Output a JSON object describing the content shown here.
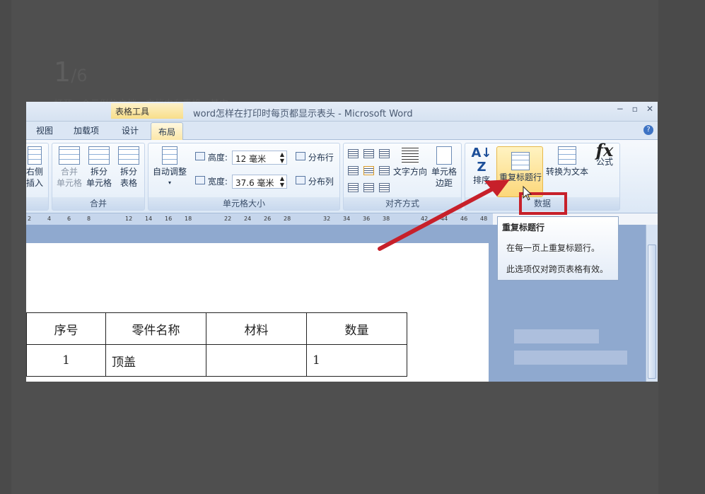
{
  "step": {
    "current": "1",
    "total": "/6"
  },
  "faded_caption": "打开一个示例的文档，文档中有表格，其中",
  "window": {
    "context_tab": "表格工具",
    "title": "word怎样在打印时每页都显示表头 - Microsoft Word",
    "buttons": [
      "−",
      "▫",
      "✕"
    ]
  },
  "tabs": [
    "视图",
    "加载项",
    "设计",
    "布局"
  ],
  "active_tab": "布局",
  "ribbon": {
    "partial_left": {
      "line1": "右侧",
      "line2": "插入"
    },
    "merge_group": {
      "label": "合并",
      "buttons": [
        {
          "line1": "合并",
          "line2": "单元格",
          "enabled": false
        },
        {
          "line1": "拆分",
          "line2": "单元格",
          "enabled": true
        },
        {
          "line1": "拆分",
          "line2": "表格",
          "enabled": true
        }
      ]
    },
    "cell_size_group": {
      "label": "单元格大小",
      "autofit": "自动调整",
      "height_label": "高度:",
      "height_value": "12 毫米",
      "width_label": "宽度:",
      "width_value": "37.6 毫米",
      "distribute_rows": "分布行",
      "distribute_cols": "分布列"
    },
    "align_group": {
      "label": "对齐方式",
      "text_direction": "文字方向",
      "cell_margin_line1": "单元格",
      "cell_margin_line2": "边距"
    },
    "data_group": {
      "label": "数据",
      "sort": "排序",
      "repeat_header": "重复标题行",
      "convert_text": "转换为文本",
      "formula": "公式"
    }
  },
  "tooltip": {
    "title": "重复标题行",
    "line1": "在每一页上重复标题行。",
    "line2": "此选项仅对跨页表格有效。"
  },
  "ruler_ticks": [
    "2",
    "4",
    "6",
    "8",
    "12",
    "14",
    "16",
    "18",
    "22",
    "24",
    "26",
    "28",
    "32",
    "34",
    "36",
    "38",
    "42",
    "44",
    "46",
    "48"
  ],
  "table": {
    "headers": [
      "序号",
      "零件名称",
      "材料",
      "数量"
    ],
    "row1": [
      "1",
      "顶盖",
      "",
      "1"
    ]
  },
  "colors": {
    "highlight": "#fcd77a",
    "red_annotation": "#c7202a",
    "ribbon_blue": "#dce8f6"
  }
}
